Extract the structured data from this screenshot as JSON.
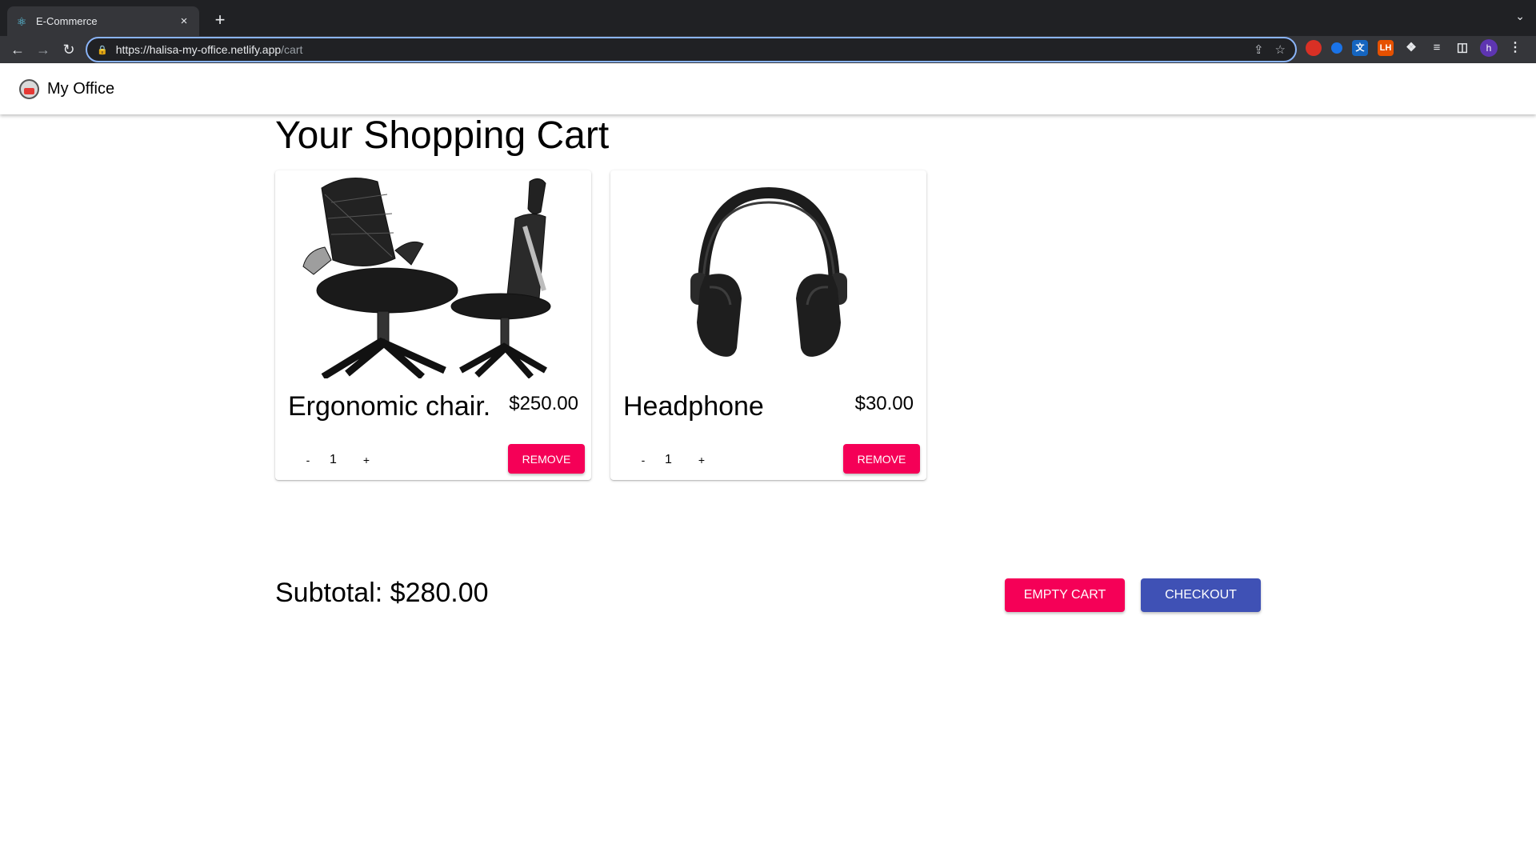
{
  "browser": {
    "tab_title": "E-Commerce",
    "url_host": "https://halisa-my-office.netlify.app",
    "url_path": "/cart",
    "profile_initial": "h"
  },
  "app": {
    "brand": "My Office"
  },
  "cart": {
    "title": "Your Shopping Cart",
    "items": [
      {
        "name": "Ergonomic chair.",
        "price": "$250.00",
        "quantity": "1",
        "minus_label": "-",
        "plus_label": "+",
        "remove_label": "Remove",
        "image": "office-chair-image"
      },
      {
        "name": "Headphone",
        "price": "$30.00",
        "quantity": "1",
        "minus_label": "-",
        "plus_label": "+",
        "remove_label": "Remove",
        "image": "headphones-image"
      }
    ],
    "subtotal": "Subtotal: $280.00",
    "empty_label": "Empty cart",
    "checkout_label": "Checkout"
  },
  "colors": {
    "secondary": "#f50057",
    "primary": "#3f51b5"
  }
}
